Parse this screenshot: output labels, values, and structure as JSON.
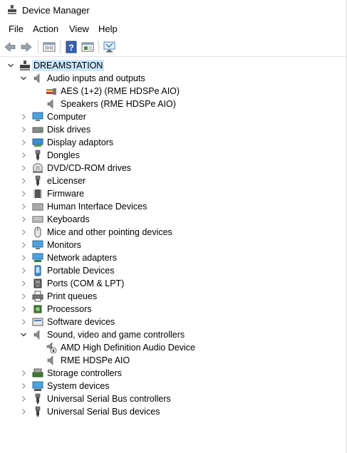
{
  "window": {
    "title": "Device Manager"
  },
  "menu": [
    "File",
    "Action",
    "View",
    "Help"
  ],
  "toolbar": {
    "buttons": [
      "back-arrow-icon",
      "forward-arrow-icon",
      "properties-icon",
      "help-icon",
      "details-icon",
      "scan-hardware-icon"
    ]
  },
  "tree": {
    "root": "DREAMSTATION",
    "categories": [
      {
        "label": "Audio inputs and outputs",
        "icon": "speaker-icon",
        "expanded": true,
        "children": [
          {
            "label": "AES (1+2) (RME HDSPe AIO)",
            "icon": "audio-connector-icon"
          },
          {
            "label": "Speakers (RME HDSPe AIO)",
            "icon": "speaker-icon"
          }
        ]
      },
      {
        "label": "Computer",
        "icon": "computer-icon",
        "expanded": false
      },
      {
        "label": "Disk drives",
        "icon": "disk-drive-icon",
        "expanded": false
      },
      {
        "label": "Display adaptors",
        "icon": "display-adapter-icon",
        "expanded": false
      },
      {
        "label": "Dongles",
        "icon": "usb-plug-icon",
        "expanded": false
      },
      {
        "label": "DVD/CD-ROM drives",
        "icon": "dvd-drive-icon",
        "expanded": false
      },
      {
        "label": "eLicenser",
        "icon": "usb-plug-icon",
        "expanded": false
      },
      {
        "label": "Firmware",
        "icon": "firmware-chip-icon",
        "expanded": false
      },
      {
        "label": "Human Interface Devices",
        "icon": "hid-keyboard-icon",
        "expanded": false
      },
      {
        "label": "Keyboards",
        "icon": "keyboard-icon",
        "expanded": false
      },
      {
        "label": "Mice and other pointing devices",
        "icon": "mouse-icon",
        "expanded": false
      },
      {
        "label": "Monitors",
        "icon": "monitor-icon",
        "expanded": false
      },
      {
        "label": "Network adapters",
        "icon": "network-adapter-icon",
        "expanded": false
      },
      {
        "label": "Portable Devices",
        "icon": "portable-device-icon",
        "expanded": false
      },
      {
        "label": "Ports (COM & LPT)",
        "icon": "port-icon",
        "expanded": false
      },
      {
        "label": "Print queues",
        "icon": "printer-icon",
        "expanded": false
      },
      {
        "label": "Processors",
        "icon": "processor-icon",
        "expanded": false
      },
      {
        "label": "Software devices",
        "icon": "software-device-icon",
        "expanded": false
      },
      {
        "label": "Sound, video and game controllers",
        "icon": "speaker-icon",
        "expanded": true,
        "children": [
          {
            "label": "AMD High Definition Audio Device",
            "icon": "speaker-warning-icon"
          },
          {
            "label": "RME HDSPe AIO",
            "icon": "speaker-icon"
          }
        ]
      },
      {
        "label": "Storage controllers",
        "icon": "storage-controller-icon",
        "expanded": false
      },
      {
        "label": "System devices",
        "icon": "system-device-icon",
        "expanded": false
      },
      {
        "label": "Universal Serial Bus controllers",
        "icon": "usb-plug-icon",
        "expanded": false
      },
      {
        "label": "Universal Serial Bus devices",
        "icon": "usb-plug-icon",
        "expanded": false
      }
    ]
  }
}
